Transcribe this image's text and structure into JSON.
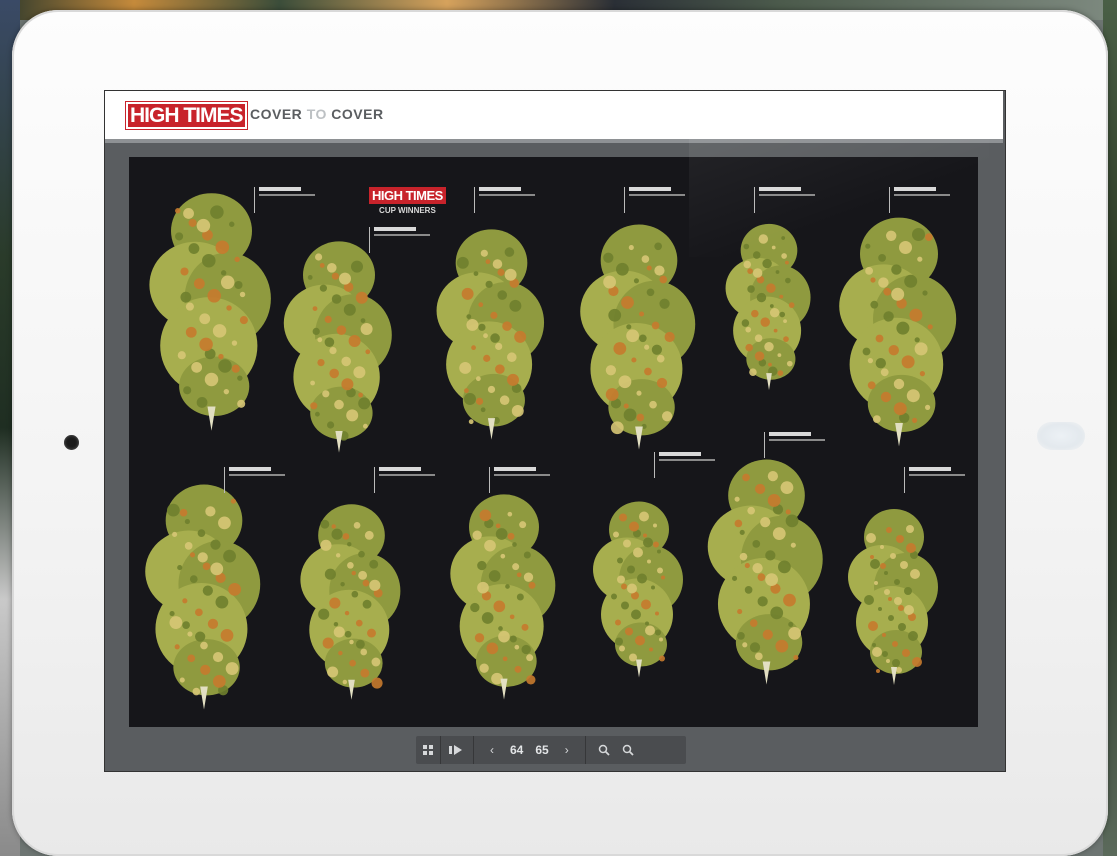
{
  "app": {
    "brand": "HIGH TIMES",
    "subtitle_a": "COVER ",
    "subtitle_to": "TO",
    "subtitle_b": " COVER"
  },
  "spread": {
    "logo_main": "HIGH TIMES",
    "logo_sub": "CUP WINNERS"
  },
  "navbar": {
    "grid_icon": "grid-icon",
    "thumbs_icon": "thumbnails-icon",
    "prev_icon": "chevron-left-icon",
    "page_left": "64",
    "page_right": "65",
    "next_icon": "chevron-right-icon",
    "zoom_out_icon": "zoom-out-icon",
    "zoom_in_icon": "zoom-in-icon"
  },
  "colors": {
    "brand_red": "#c8232b",
    "spread_bg": "#16161a",
    "bud_green": "#9aa64a",
    "bud_orange": "#c77a2e"
  }
}
